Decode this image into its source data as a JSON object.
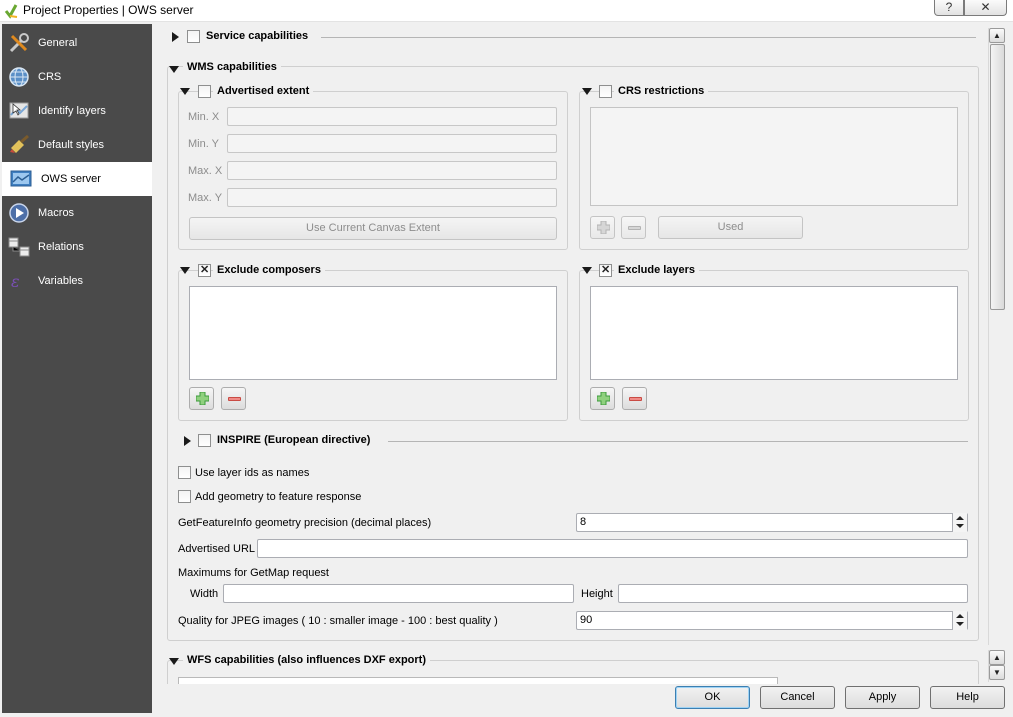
{
  "window": {
    "title": "Project Properties | OWS server",
    "help_label": "?",
    "close_label": "✕"
  },
  "sidebar": {
    "items": [
      {
        "label": "General",
        "icon": "wrench-icon"
      },
      {
        "label": "CRS",
        "icon": "globe-icon"
      },
      {
        "label": "Identify layers",
        "icon": "identify-icon"
      },
      {
        "label": "Default styles",
        "icon": "paintbrush-icon"
      },
      {
        "label": "OWS server",
        "icon": "ows-server-icon",
        "active": true
      },
      {
        "label": "Macros",
        "icon": "macros-icon"
      },
      {
        "label": "Relations",
        "icon": "relations-icon"
      },
      {
        "label": "Variables",
        "icon": "variables-icon"
      }
    ]
  },
  "service_capabilities": {
    "title": "Service capabilities",
    "checked": false,
    "expanded": false
  },
  "wms": {
    "title": "WMS capabilities",
    "advertised_extent": {
      "title": "Advertised extent",
      "checked": false,
      "min_x_label": "Min. X",
      "min_y_label": "Min. Y",
      "max_x_label": "Max. X",
      "max_y_label": "Max. Y",
      "min_x_value": "",
      "min_y_value": "",
      "max_x_value": "",
      "max_y_value": "",
      "use_canvas_button": "Use Current Canvas Extent"
    },
    "crs_restrictions": {
      "title": "CRS restrictions",
      "checked": false,
      "used_button": "Used"
    },
    "exclude_composers": {
      "title": "Exclude composers",
      "checked": true
    },
    "exclude_layers": {
      "title": "Exclude layers",
      "checked": true
    },
    "inspire": {
      "title": "INSPIRE (European directive)",
      "checked": false,
      "expanded": false
    },
    "use_layer_ids_label": "Use layer ids as names",
    "use_layer_ids_checked": false,
    "add_geometry_label": "Add geometry to feature response",
    "add_geometry_checked": false,
    "precision_label": "GetFeatureInfo geometry precision (decimal places)",
    "precision_value": "8",
    "advertised_url_label": "Advertised URL",
    "advertised_url_value": "",
    "max_getmap_label": "Maximums for GetMap request",
    "width_label": "Width",
    "width_value": "",
    "height_label": "Height",
    "height_value": "",
    "jpeg_quality_label": "Quality for JPEG images ( 10 : smaller image - 100 : best quality )",
    "jpeg_quality_value": "90"
  },
  "wfs": {
    "title": "WFS capabilities (also influences DXF export)"
  },
  "buttons": {
    "ok": "OK",
    "cancel": "Cancel",
    "apply": "Apply",
    "help": "Help"
  },
  "colors": {
    "sidebar_bg": "#4a4a4a",
    "add_green": "#3c9a3c",
    "remove_red": "#d9534f"
  }
}
